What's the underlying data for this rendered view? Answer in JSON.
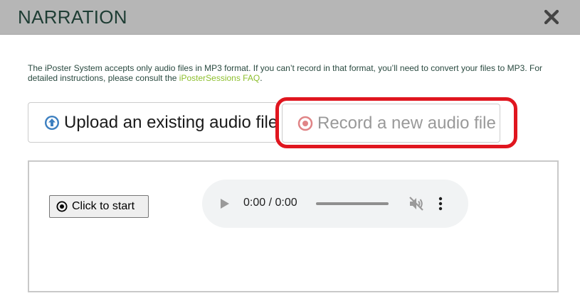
{
  "modal": {
    "title": "NARRATION",
    "close_icon": "close-icon"
  },
  "info": {
    "text": "The iPoster System accepts only audio files in MP3 format. If you can’t record in that format, you’ll need to convert your files to MP3. For detailed instructions, please consult the ",
    "link_label": "iPosterSessions FAQ",
    "text_end": "."
  },
  "tabs": [
    {
      "label": "Upload an existing audio file",
      "icon": "upload-circle-icon",
      "active": true
    },
    {
      "label": "Record a new audio file",
      "icon": "record-circle-icon",
      "active": false
    }
  ],
  "recorder": {
    "start_label": "Click to start",
    "start_icon": "record-dot-icon"
  },
  "audio_player": {
    "time": "0:00 / 0:00",
    "progress": 0,
    "muted": true
  },
  "colors": {
    "header_bg": "#b6b6b6",
    "title": "#1e3d34",
    "link": "#8dbf2e",
    "upload_icon": "#3c7fc0",
    "record_icon": "#e08486",
    "highlight": "#e0161f"
  }
}
